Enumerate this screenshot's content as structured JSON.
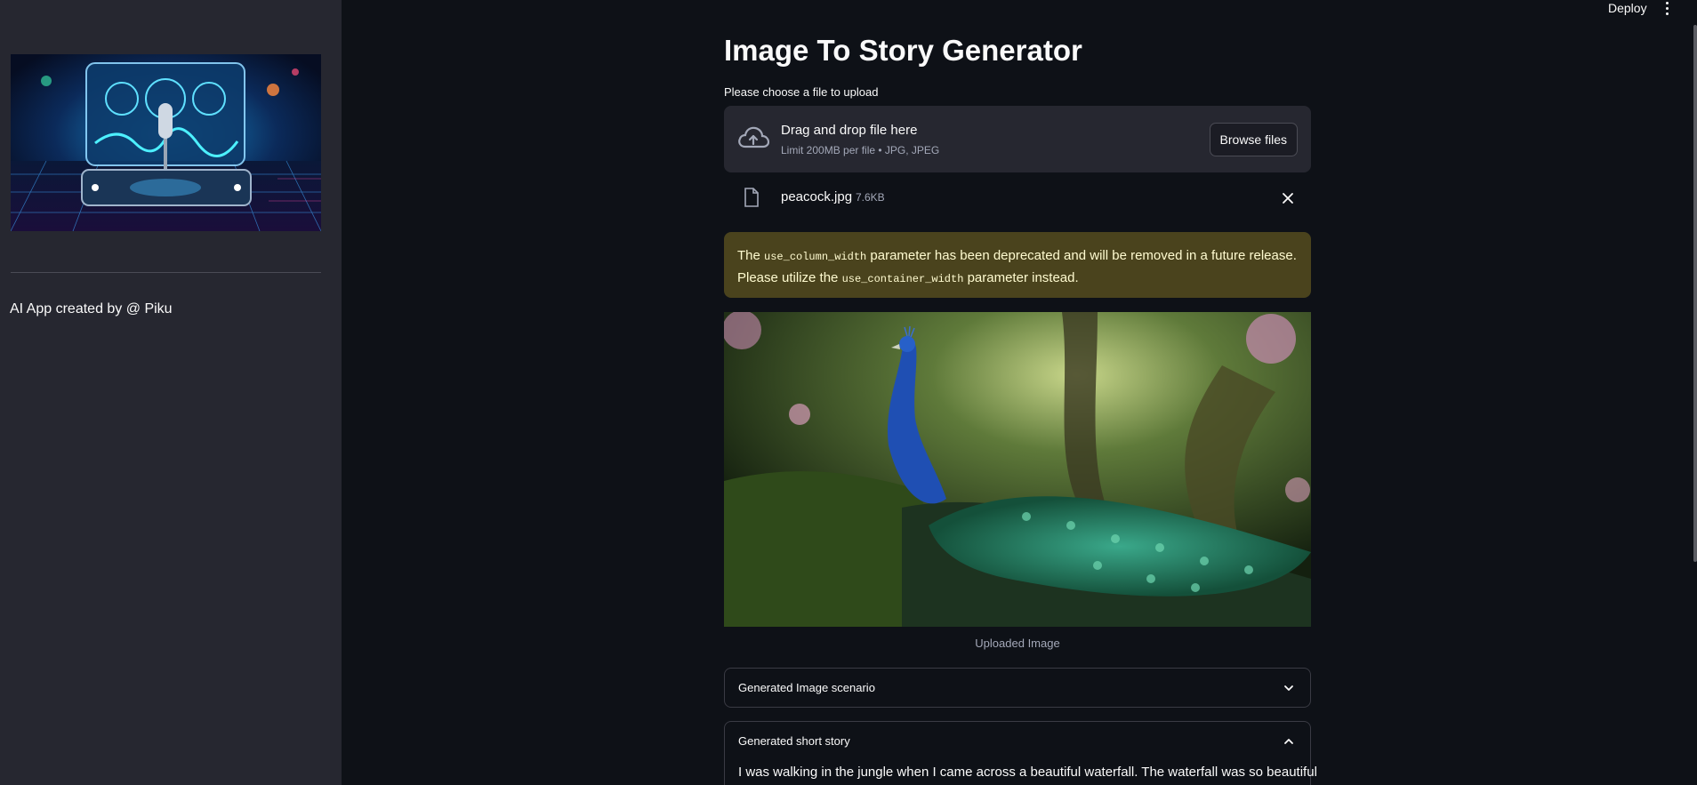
{
  "header": {
    "deploy_label": "Deploy",
    "menu_icon": "vertical-ellipsis-icon"
  },
  "sidebar": {
    "credit": "AI App created by @ Piku",
    "image_icon": "microphone-hologram-illustration"
  },
  "main": {
    "title": "Image To Story Generator",
    "upload_label": "Please choose a file to upload",
    "dropzone": {
      "title": "Drag and drop file here",
      "limit": "Limit 200MB per file • JPG, JPEG",
      "browse_label": "Browse files",
      "icon": "cloud-upload-icon"
    },
    "file": {
      "name": "peacock.jpg",
      "size": "7.6KB",
      "icon": "file-icon",
      "remove_icon": "close-icon"
    },
    "warning": {
      "prefix": "The ",
      "code1": "use_column_width",
      "middle": " parameter has been deprecated and will be removed in a future release. Please utilize the ",
      "code2": "use_container_width",
      "suffix": " parameter instead."
    },
    "image_caption": "Uploaded Image",
    "expanders": [
      {
        "title": "Generated Image scenario",
        "expanded": false
      },
      {
        "title": "Generated short story",
        "expanded": true,
        "body": "I was walking in the jungle when I came across a beautiful waterfall. The waterfall was so beautiful"
      }
    ]
  },
  "colors": {
    "background": "#0e1117",
    "sidebar": "#262730",
    "warning_bg": "#4a431d",
    "warning_text": "#fffbd0"
  }
}
